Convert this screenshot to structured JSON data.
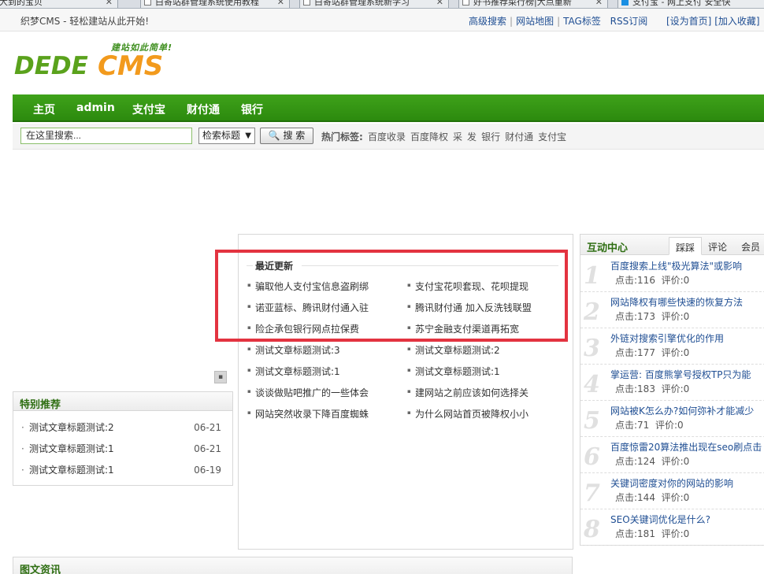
{
  "browser_tabs": [
    {
      "title": "大到的宝贝"
    },
    {
      "title": "白寄站群管理系统使用教程"
    },
    {
      "title": "白寄站群管理系统新学习"
    },
    {
      "title": "好书推荐菜行榜|大点重新"
    },
    {
      "title": "支付宝 - 网上支付 安全快"
    }
  ],
  "topbar": {
    "slogan": "织梦CMS - 轻松建站从此开始!",
    "links": [
      "高级搜索",
      "网站地图",
      "TAG标签",
      "RSS订阅"
    ],
    "right_links": [
      "[设为首页]",
      "[加入收藏]"
    ]
  },
  "logo": {
    "tagline": "建站如此简单!",
    "part1": "DEDE",
    "part2": "CMS"
  },
  "nav": [
    "主页",
    "admin",
    "支付宝",
    "财付通",
    "银行"
  ],
  "search": {
    "placeholder": "在这里搜索...",
    "select_value": "检索标题",
    "button_label": "搜 索",
    "hot_label": "热门标签:",
    "hot_tags": [
      "百度收录",
      "百度降权",
      "采",
      "发",
      "银行",
      "财付通",
      "支付宝"
    ]
  },
  "special": {
    "title": "特别推荐",
    "items": [
      {
        "title": "测试文章标题测试:2",
        "date": "06-21"
      },
      {
        "title": "测试文章标题测试:1",
        "date": "06-21"
      },
      {
        "title": "测试文章标题测试:1",
        "date": "06-19"
      }
    ]
  },
  "tuwen": {
    "title": "图文资讯"
  },
  "recent": {
    "title": "最近更新",
    "left": [
      "骗取他人支付宝信息盗刷绑",
      "诺亚蓝标、腾讯财付通入驻",
      "险企承包银行网点拉保费",
      "测试文章标题测试:3",
      "测试文章标题测试:1",
      "谈谈做贴吧推广的一些体会",
      "网站突然收录下降百度蜘蛛"
    ],
    "right": [
      "支付宝花呗套现、花呗提现",
      "腾讯财付通 加入反洗钱联盟",
      "苏宁金融支付渠道再拓宽",
      "测试文章标题测试:2",
      "测试文章标题测试:1",
      "建网站之前应该如何选择关",
      "为什么网站首页被降权小小"
    ]
  },
  "interact": {
    "title": "互动中心",
    "tabs": [
      "踩踩",
      "评论",
      "会员"
    ],
    "items": [
      {
        "num": "1",
        "title": "百度搜索上线\"极光算法\"或影响",
        "clicks": "点击:116",
        "comments": "评价:0"
      },
      {
        "num": "2",
        "title": "网站降权有哪些快速的恢复方法",
        "clicks": "点击:173",
        "comments": "评价:0"
      },
      {
        "num": "3",
        "title": "外链对搜索引擎优化的作用",
        "clicks": "点击:177",
        "comments": "评价:0"
      },
      {
        "num": "4",
        "title": "掌运营: 百度熊掌号授权TP只为能",
        "clicks": "点击:183",
        "comments": "评价:0"
      },
      {
        "num": "5",
        "title": "网站被K怎么办?如何弥补才能减少",
        "clicks": "点击:71",
        "comments": "评价:0"
      },
      {
        "num": "6",
        "title": "百度惊雷20算法推出现在seo刷点击",
        "clicks": "点击:124",
        "comments": "评价:0"
      },
      {
        "num": "7",
        "title": "关键词密度对你的网站的影响",
        "clicks": "点击:144",
        "comments": "评价:0"
      },
      {
        "num": "8",
        "title": "SEO关键词优化是什么?",
        "clicks": "点击:181",
        "comments": "评价:0"
      }
    ]
  }
}
